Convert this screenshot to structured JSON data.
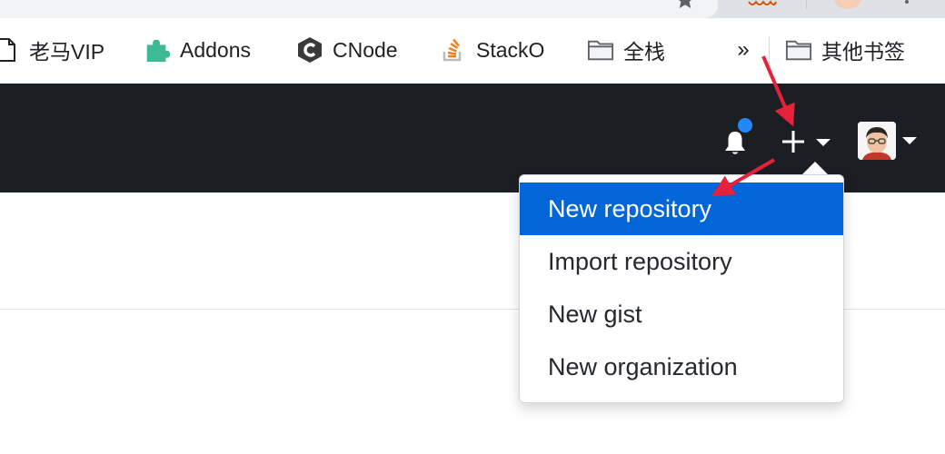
{
  "bookmarks": {
    "items": [
      {
        "label": "老马VIP",
        "icon": "document-icon"
      },
      {
        "label": "Addons",
        "icon": "puzzle-piece-icon"
      },
      {
        "label": "CNode",
        "icon": "cnode-logo-icon"
      },
      {
        "label": "StackO",
        "icon": "stackoverflow-icon"
      },
      {
        "label": "全栈",
        "icon": "folder-icon"
      }
    ],
    "overflow": "»",
    "other": {
      "label": "其他书签",
      "icon": "folder-icon"
    }
  },
  "header": {
    "icons": [
      "bell-icon",
      "plus-icon",
      "caret-down-icon",
      "avatar"
    ],
    "notification_color": "#2188ff"
  },
  "dropdown": {
    "items": [
      {
        "label": "New repository",
        "active": true
      },
      {
        "label": "Import repository",
        "active": false
      },
      {
        "label": "New gist",
        "active": false
      },
      {
        "label": "New organization",
        "active": false
      }
    ]
  },
  "colors": {
    "header_bg": "#1b1f23",
    "active_item_bg": "#0366d6",
    "annotation_arrow": "#e8213a",
    "cnode_logo": "#3a3a3a",
    "stackoverflow_orange": "#f48024",
    "addons_green": "#3bba93"
  }
}
